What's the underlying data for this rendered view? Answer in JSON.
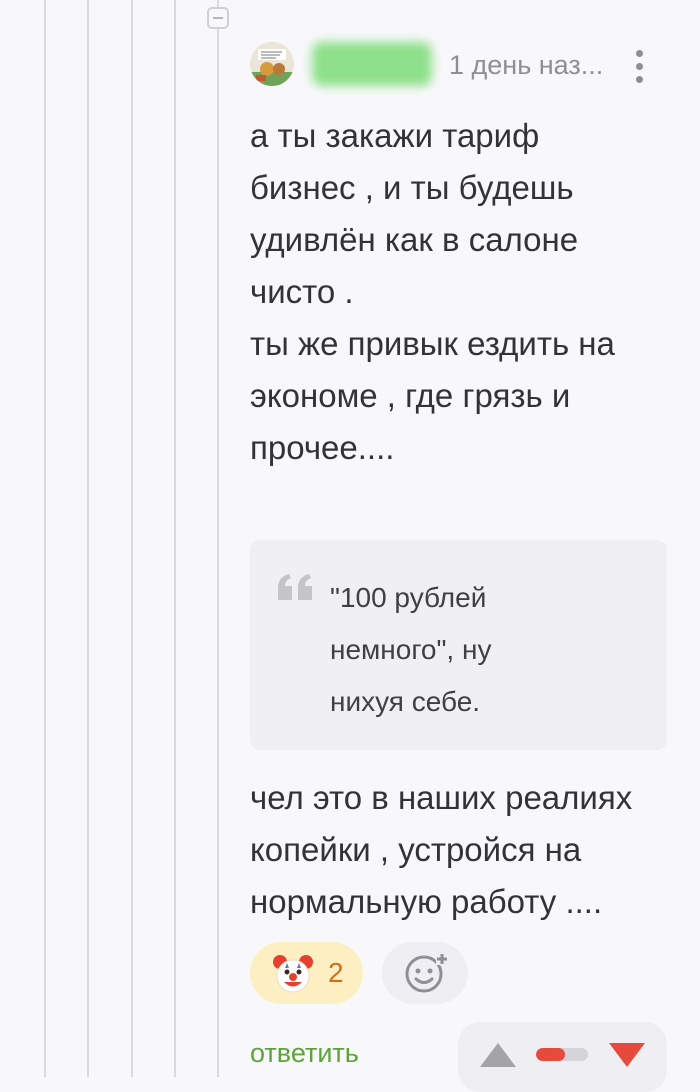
{
  "comment": {
    "timestamp": "1 день наз...",
    "text_lines": [
      "а ты закажи тариф",
      "бизнес , и ты будешь",
      "удивлён как в салоне",
      "чисто .",
      "ты же привык ездить на",
      "экономе , где грязь и",
      "прочее...."
    ],
    "quote_lines": [
      "\"100 рублей",
      "немного\", ну",
      "нихуя себе."
    ],
    "text_after_lines": [
      "чел это в наших реалиях",
      "копейки , устройся на",
      "нормальную работу ...."
    ]
  },
  "reactions": [
    {
      "icon": "clown-face-icon",
      "count": "2"
    }
  ],
  "actions": {
    "reply_label": "ответить"
  },
  "rating": {
    "negative_share": 0.55
  },
  "colors": {
    "reply_link": "#5ea33a",
    "reaction_bg": "#fcefc2",
    "reaction_count": "#d0701c",
    "vote_down": "#e64a3c",
    "vote_up": "#a3a3a8"
  }
}
